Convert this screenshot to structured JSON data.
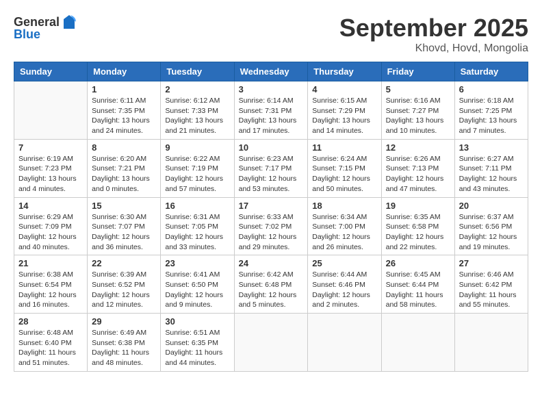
{
  "header": {
    "logo_general": "General",
    "logo_blue": "Blue",
    "month": "September 2025",
    "location": "Khovd, Hovd, Mongolia"
  },
  "weekdays": [
    "Sunday",
    "Monday",
    "Tuesday",
    "Wednesday",
    "Thursday",
    "Friday",
    "Saturday"
  ],
  "weeks": [
    [
      {
        "day": "",
        "info": ""
      },
      {
        "day": "1",
        "info": "Sunrise: 6:11 AM\nSunset: 7:35 PM\nDaylight: 13 hours and 24 minutes."
      },
      {
        "day": "2",
        "info": "Sunrise: 6:12 AM\nSunset: 7:33 PM\nDaylight: 13 hours and 21 minutes."
      },
      {
        "day": "3",
        "info": "Sunrise: 6:14 AM\nSunset: 7:31 PM\nDaylight: 13 hours and 17 minutes."
      },
      {
        "day": "4",
        "info": "Sunrise: 6:15 AM\nSunset: 7:29 PM\nDaylight: 13 hours and 14 minutes."
      },
      {
        "day": "5",
        "info": "Sunrise: 6:16 AM\nSunset: 7:27 PM\nDaylight: 13 hours and 10 minutes."
      },
      {
        "day": "6",
        "info": "Sunrise: 6:18 AM\nSunset: 7:25 PM\nDaylight: 13 hours and 7 minutes."
      }
    ],
    [
      {
        "day": "7",
        "info": "Sunrise: 6:19 AM\nSunset: 7:23 PM\nDaylight: 13 hours and 4 minutes."
      },
      {
        "day": "8",
        "info": "Sunrise: 6:20 AM\nSunset: 7:21 PM\nDaylight: 13 hours and 0 minutes."
      },
      {
        "day": "9",
        "info": "Sunrise: 6:22 AM\nSunset: 7:19 PM\nDaylight: 12 hours and 57 minutes."
      },
      {
        "day": "10",
        "info": "Sunrise: 6:23 AM\nSunset: 7:17 PM\nDaylight: 12 hours and 53 minutes."
      },
      {
        "day": "11",
        "info": "Sunrise: 6:24 AM\nSunset: 7:15 PM\nDaylight: 12 hours and 50 minutes."
      },
      {
        "day": "12",
        "info": "Sunrise: 6:26 AM\nSunset: 7:13 PM\nDaylight: 12 hours and 47 minutes."
      },
      {
        "day": "13",
        "info": "Sunrise: 6:27 AM\nSunset: 7:11 PM\nDaylight: 12 hours and 43 minutes."
      }
    ],
    [
      {
        "day": "14",
        "info": "Sunrise: 6:29 AM\nSunset: 7:09 PM\nDaylight: 12 hours and 40 minutes."
      },
      {
        "day": "15",
        "info": "Sunrise: 6:30 AM\nSunset: 7:07 PM\nDaylight: 12 hours and 36 minutes."
      },
      {
        "day": "16",
        "info": "Sunrise: 6:31 AM\nSunset: 7:05 PM\nDaylight: 12 hours and 33 minutes."
      },
      {
        "day": "17",
        "info": "Sunrise: 6:33 AM\nSunset: 7:02 PM\nDaylight: 12 hours and 29 minutes."
      },
      {
        "day": "18",
        "info": "Sunrise: 6:34 AM\nSunset: 7:00 PM\nDaylight: 12 hours and 26 minutes."
      },
      {
        "day": "19",
        "info": "Sunrise: 6:35 AM\nSunset: 6:58 PM\nDaylight: 12 hours and 22 minutes."
      },
      {
        "day": "20",
        "info": "Sunrise: 6:37 AM\nSunset: 6:56 PM\nDaylight: 12 hours and 19 minutes."
      }
    ],
    [
      {
        "day": "21",
        "info": "Sunrise: 6:38 AM\nSunset: 6:54 PM\nDaylight: 12 hours and 16 minutes."
      },
      {
        "day": "22",
        "info": "Sunrise: 6:39 AM\nSunset: 6:52 PM\nDaylight: 12 hours and 12 minutes."
      },
      {
        "day": "23",
        "info": "Sunrise: 6:41 AM\nSunset: 6:50 PM\nDaylight: 12 hours and 9 minutes."
      },
      {
        "day": "24",
        "info": "Sunrise: 6:42 AM\nSunset: 6:48 PM\nDaylight: 12 hours and 5 minutes."
      },
      {
        "day": "25",
        "info": "Sunrise: 6:44 AM\nSunset: 6:46 PM\nDaylight: 12 hours and 2 minutes."
      },
      {
        "day": "26",
        "info": "Sunrise: 6:45 AM\nSunset: 6:44 PM\nDaylight: 11 hours and 58 minutes."
      },
      {
        "day": "27",
        "info": "Sunrise: 6:46 AM\nSunset: 6:42 PM\nDaylight: 11 hours and 55 minutes."
      }
    ],
    [
      {
        "day": "28",
        "info": "Sunrise: 6:48 AM\nSunset: 6:40 PM\nDaylight: 11 hours and 51 minutes."
      },
      {
        "day": "29",
        "info": "Sunrise: 6:49 AM\nSunset: 6:38 PM\nDaylight: 11 hours and 48 minutes."
      },
      {
        "day": "30",
        "info": "Sunrise: 6:51 AM\nSunset: 6:35 PM\nDaylight: 11 hours and 44 minutes."
      },
      {
        "day": "",
        "info": ""
      },
      {
        "day": "",
        "info": ""
      },
      {
        "day": "",
        "info": ""
      },
      {
        "day": "",
        "info": ""
      }
    ]
  ]
}
